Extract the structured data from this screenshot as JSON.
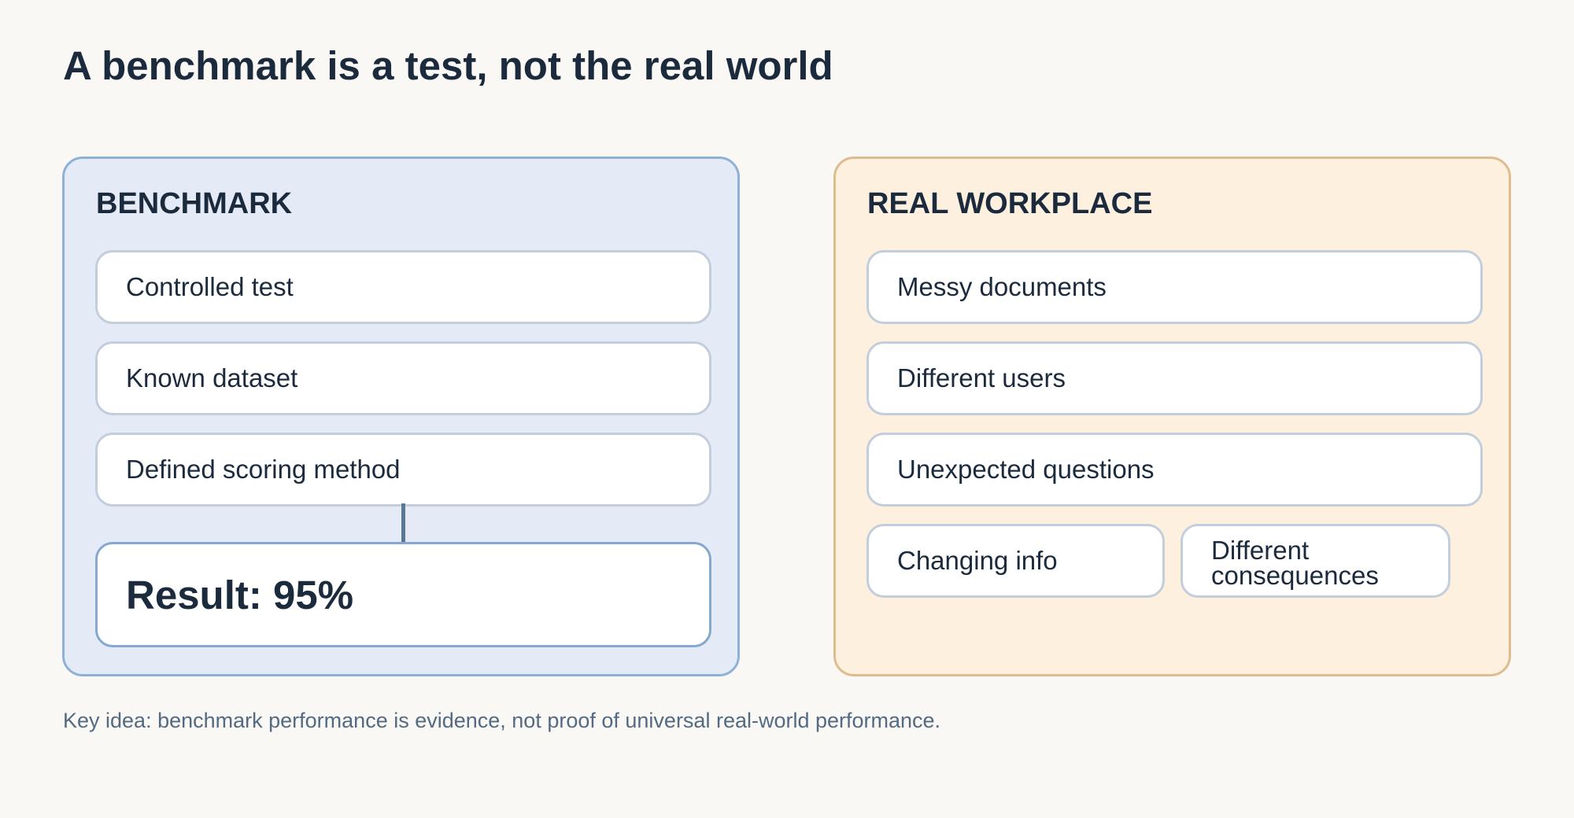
{
  "title": "A benchmark is a test, not the real world",
  "benchmark": {
    "heading": "BENCHMARK",
    "items": [
      "Controlled test",
      "Known dataset",
      "Defined scoring method"
    ],
    "result": "Result: 95%"
  },
  "workplace": {
    "heading": "REAL WORKPLACE",
    "items": [
      "Messy documents",
      "Different users",
      "Unexpected questions",
      "Changing info",
      "Different consequences"
    ]
  },
  "key_idea": "Key idea: benchmark performance is evidence, not proof of universal real-world performance.",
  "colors": {
    "background": "#faf8f5",
    "benchmark_fill": "#e4ebf6",
    "benchmark_border": "#8fb1d5",
    "workplace_fill": "#fdf0df",
    "workplace_border": "#ddbd8d",
    "text": "#1b2b3d",
    "muted_text": "#526a82"
  }
}
